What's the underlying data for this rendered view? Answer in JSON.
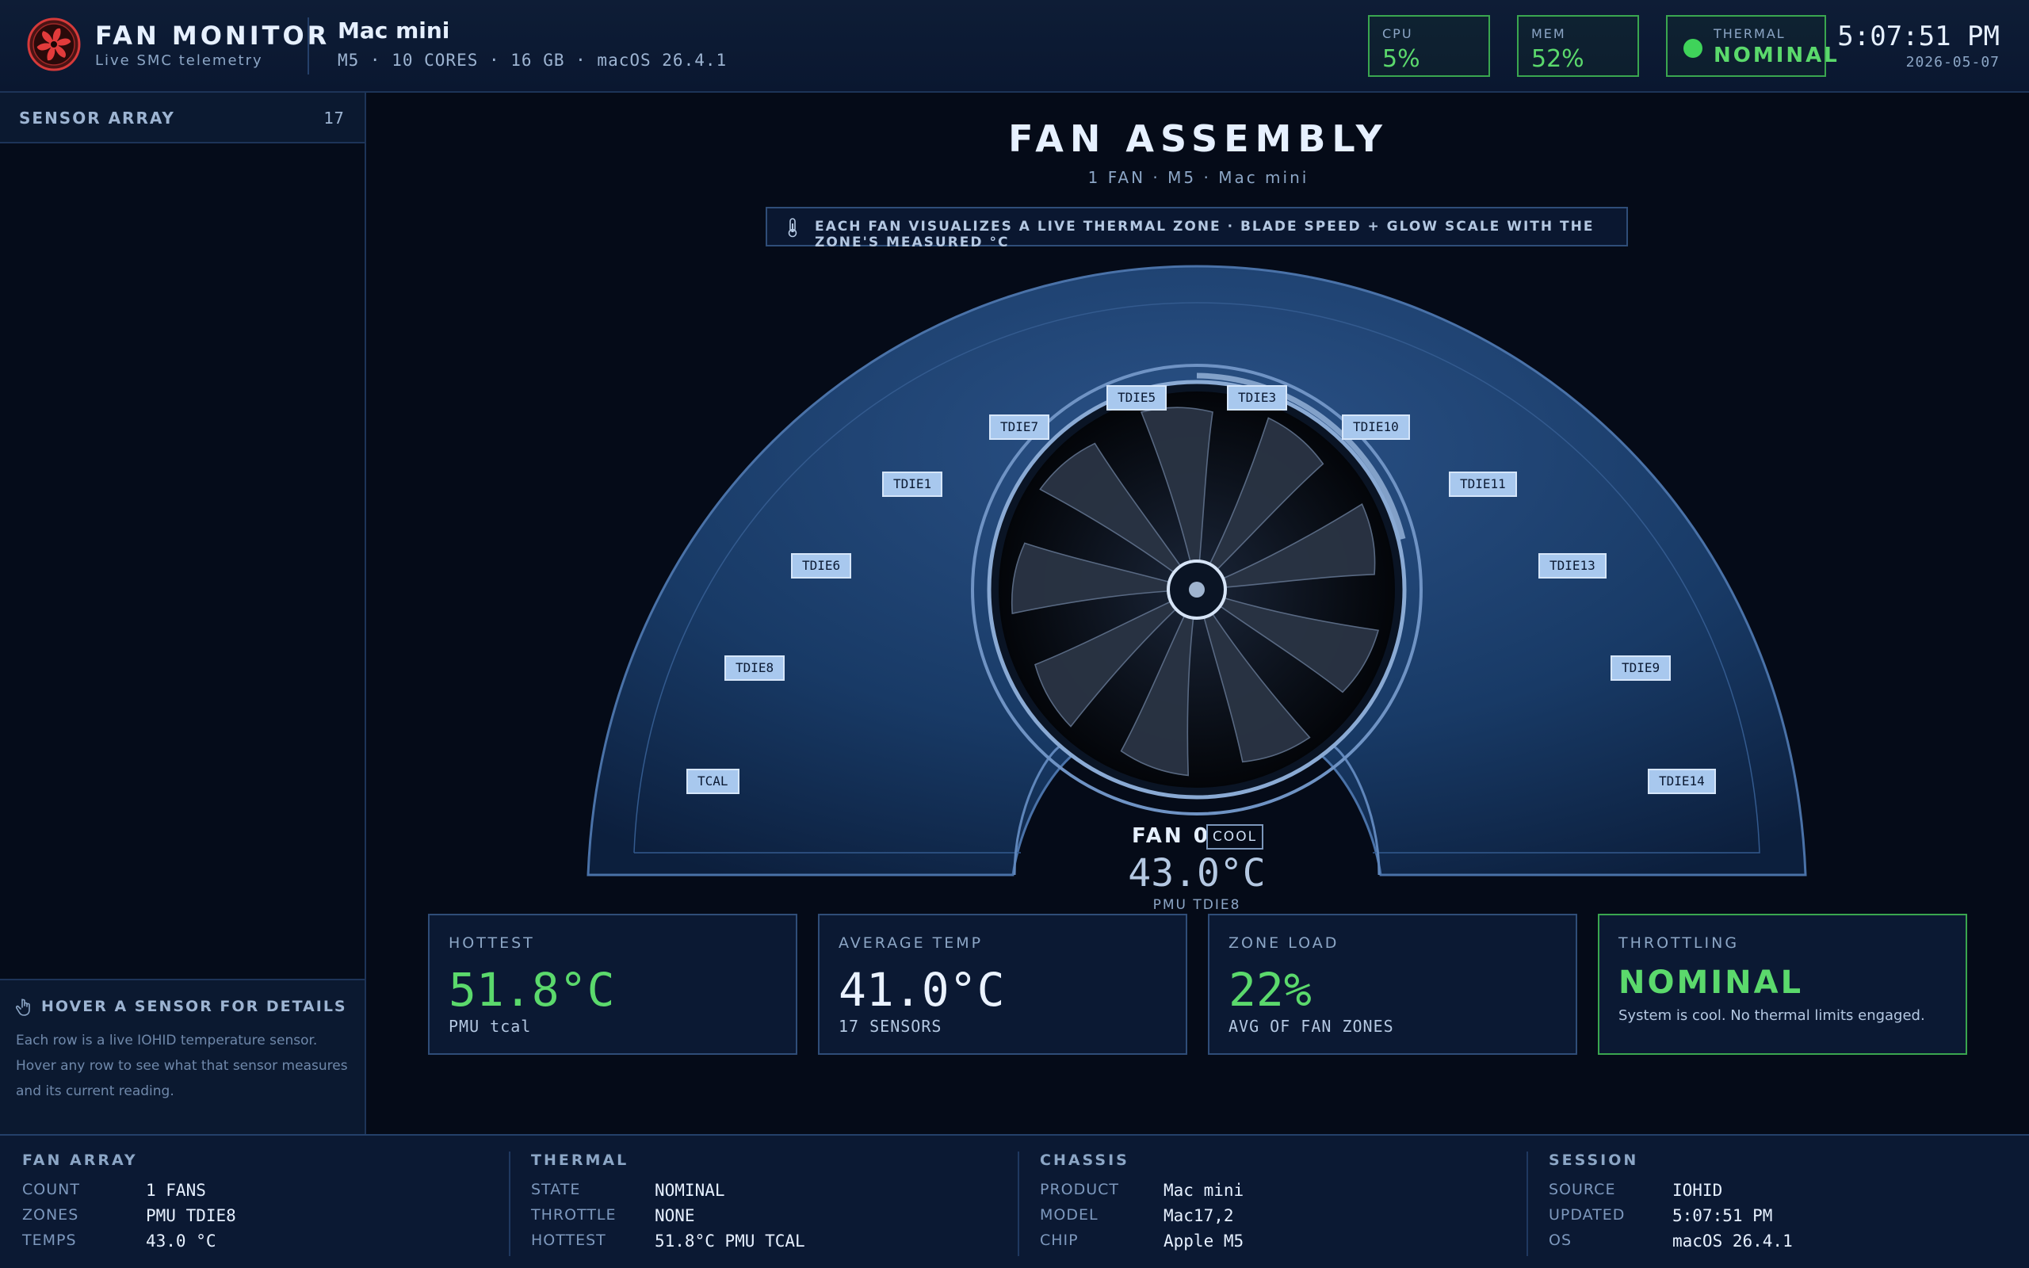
{
  "header": {
    "brand_title": "FAN MONITOR",
    "brand_subtitle": "Live SMC telemetry",
    "device_name": "Mac mini",
    "device_specs": "M5 · 10 CORES · 16 GB · macOS 26.4.1",
    "cpu_label": "CPU",
    "cpu_value": "5%",
    "mem_label": "MEM",
    "mem_value": "52%",
    "thermal_label": "THERMAL",
    "thermal_value": "NOMINAL",
    "time": "5:07:51 PM",
    "date": "2026-05-07"
  },
  "sidebar": {
    "title": "SENSOR ARRAY",
    "count": "17",
    "hint_title": "HOVER A SENSOR FOR DETAILS",
    "hint_body": "Each row is a live IOHID temperature sensor. Hover any row to see what that sensor measures and its current reading."
  },
  "main": {
    "title": "FAN ASSEMBLY",
    "subtitle": "1 FAN · M5 · Mac mini",
    "banner": "EACH FAN VISUALIZES A LIVE THERMAL ZONE · BLADE SPEED + GLOW SCALE WITH THE ZONE'S MEASURED °C",
    "fan": {
      "name": "FAN 0",
      "state": "COOL",
      "temp": "43.0°C",
      "zone": "PMU TDIE8"
    },
    "sensor_tags": [
      "TCAL",
      "TDIE8",
      "TDIE6",
      "TDIE1",
      "TDIE7",
      "TDIE5",
      "TDIE3",
      "TDIE10",
      "TDIE11",
      "TDIE13",
      "TDIE9",
      "TDIE14"
    ]
  },
  "cards": {
    "hottest": {
      "label": "HOTTEST",
      "value": "51.8°C",
      "sub": "PMU tcal"
    },
    "average": {
      "label": "AVERAGE TEMP",
      "value": "41.0°C",
      "sub": "17 SENSORS"
    },
    "load": {
      "label": "ZONE LOAD",
      "value": "22%",
      "sub": "AVG OF FAN ZONES"
    },
    "throttling": {
      "label": "THROTTLING",
      "value": "NOMINAL",
      "note": "System is cool. No thermal limits engaged."
    }
  },
  "footer": {
    "fan_array": {
      "title": "FAN ARRAY",
      "rows": [
        [
          "COUNT",
          "1 FANS"
        ],
        [
          "ZONES",
          "PMU TDIE8"
        ],
        [
          "TEMPS",
          "43.0 °C"
        ]
      ]
    },
    "thermal": {
      "title": "THERMAL",
      "rows": [
        [
          "STATE",
          "NOMINAL"
        ],
        [
          "THROTTLE",
          "NONE"
        ],
        [
          "HOTTEST",
          "51.8°C PMU TCAL"
        ]
      ]
    },
    "chassis": {
      "title": "CHASSIS",
      "rows": [
        [
          "PRODUCT",
          "Mac mini"
        ],
        [
          "MODEL",
          "Mac17,2"
        ],
        [
          "CHIP",
          "Apple M5"
        ]
      ]
    },
    "session": {
      "title": "SESSION",
      "rows": [
        [
          "SOURCE",
          "IOHID"
        ],
        [
          "UPDATED",
          "5:07:51 PM"
        ],
        [
          "OS",
          "macOS 26.4.1"
        ]
      ]
    }
  },
  "colors": {
    "background": "#050b18",
    "accent_green": "#5bd96c",
    "panel": "#0b1933",
    "logo_red": "#d63a3a"
  }
}
